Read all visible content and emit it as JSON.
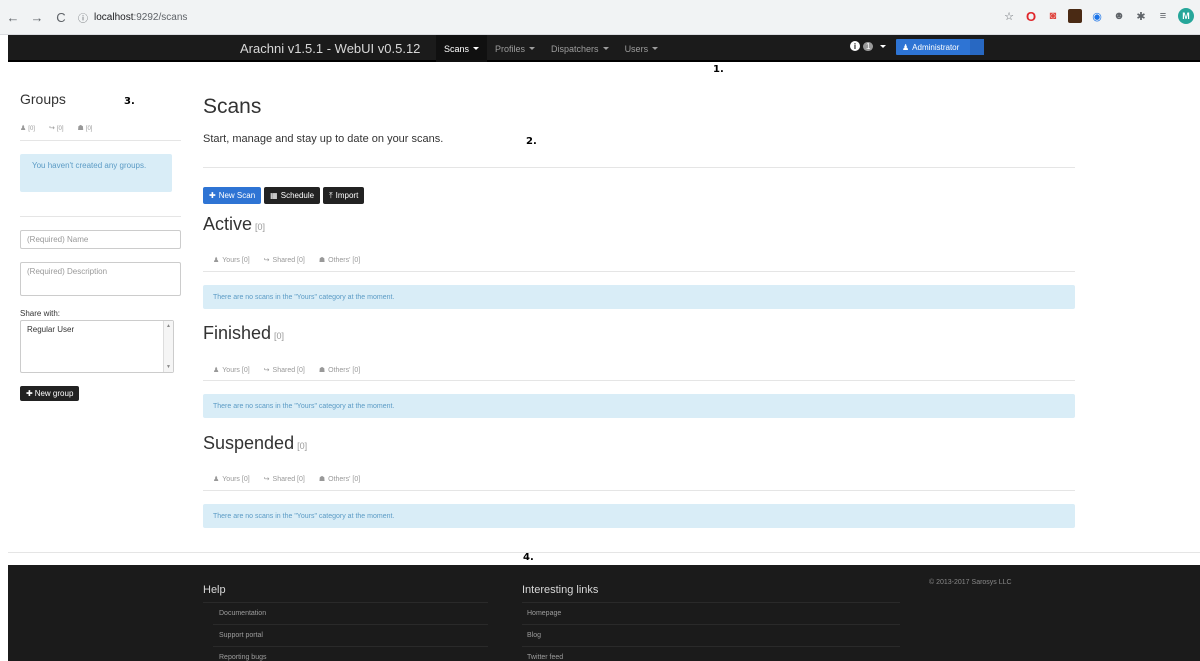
{
  "browser": {
    "url_host": "localhost",
    "url_path": ":9292/scans",
    "profile_initial": "M"
  },
  "navbar": {
    "brand": "Arachni v1.5.1 - WebUI v0.5.12",
    "menu": [
      "Scans",
      "Profiles",
      "Dispatchers",
      "Users"
    ],
    "notification_count": "1",
    "admin_label": "Administrator"
  },
  "annotations": {
    "a1": "1.",
    "a2": "2.",
    "a3": "3.",
    "a4": "4."
  },
  "sidebar": {
    "title": "Groups",
    "tabs": [
      "[0]",
      "[0]",
      "[0]"
    ],
    "alert": "You haven't created any groups.",
    "name_placeholder": "(Required) Name",
    "description_placeholder": "(Required) Description",
    "share_label": "Share with:",
    "share_option": "Regular User",
    "new_group_label": "New group"
  },
  "main": {
    "title": "Scans",
    "subtitle": "Start, manage and stay up to date on your scans.",
    "buttons": {
      "new_scan": "New Scan",
      "schedule": "Schedule",
      "import": "Import"
    },
    "sections": [
      {
        "title": "Active",
        "count": "[0]",
        "tabs": [
          "Yours [0]",
          "Shared [0]",
          "Others' [0]"
        ],
        "empty": "There are no scans in the \"Yours\" category at the moment."
      },
      {
        "title": "Finished",
        "count": "[0]",
        "tabs": [
          "Yours [0]",
          "Shared [0]",
          "Others' [0]"
        ],
        "empty": "There are no scans in the \"Yours\" category at the moment."
      },
      {
        "title": "Suspended",
        "count": "[0]",
        "tabs": [
          "Yours [0]",
          "Shared [0]",
          "Others' [0]"
        ],
        "empty": "There are no scans in the \"Yours\" category at the moment."
      }
    ]
  },
  "footer": {
    "help_heading": "Help",
    "help_links": [
      "Documentation",
      "Support portal",
      "Reporting bugs"
    ],
    "links_heading": "Interesting links",
    "links": [
      "Homepage",
      "Blog",
      "Twitter feed"
    ],
    "copyright": "© 2013-2017 Sarosys LLC"
  },
  "colors": {
    "navbar_bg": "#1b1b1b",
    "primary": "#2e74d4",
    "info_bg": "#d9edf7",
    "info_text": "#5b9bc5"
  }
}
